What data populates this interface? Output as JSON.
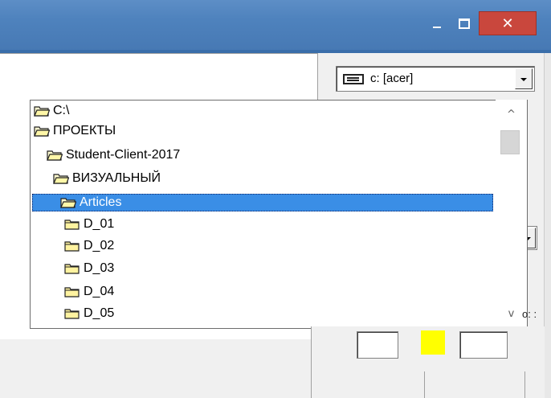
{
  "window": {
    "titlebar_color": "#4e82bd",
    "close_color": "#c9473d",
    "minimize_glyph": "minimize-icon",
    "maximize_glyph": "maximize-icon",
    "close_label": "✕"
  },
  "drive_combo": {
    "icon": "drive-icon",
    "value": "c: [acer]"
  },
  "folder_list": {
    "items": [
      {
        "label": "C:\\",
        "icon": "open-folder-icon",
        "selected": false
      },
      {
        "label": "ПРОЕКТЫ",
        "icon": "open-folder-icon",
        "selected": false
      },
      {
        "label": "Student-Client-2017",
        "icon": "open-folder-icon",
        "selected": false
      },
      {
        "label": "ВИЗУАЛЬНЫЙ",
        "icon": "open-folder-icon",
        "selected": false
      },
      {
        "label": "Articles",
        "icon": "open-folder-icon",
        "selected": true
      },
      {
        "label": "D_01",
        "icon": "folder-icon",
        "selected": false
      },
      {
        "label": "D_02",
        "icon": "folder-icon",
        "selected": false
      },
      {
        "label": "D_03",
        "icon": "folder-icon",
        "selected": false
      },
      {
        "label": "D_04",
        "icon": "folder-icon",
        "selected": false
      },
      {
        "label": "D_05",
        "icon": "folder-icon",
        "selected": false
      }
    ],
    "selection_color": "#3a8ee6"
  },
  "scrollbar": {
    "up_glyph": "^",
    "down_glyph": "v",
    "trailing_text": "o: :"
  },
  "swatch": {
    "color": "#ffff00"
  }
}
